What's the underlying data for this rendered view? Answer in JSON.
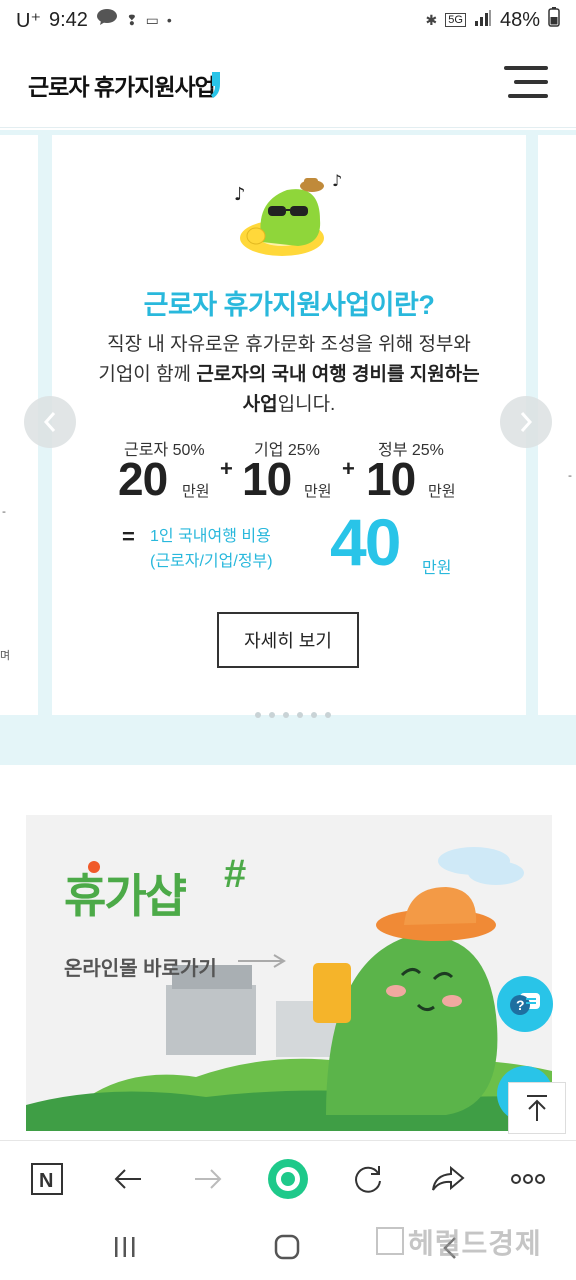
{
  "status_bar": {
    "carrier": "U⁺",
    "time": "9:42",
    "talk_badge": "TALK",
    "network": "5G",
    "battery": "48%"
  },
  "header": {
    "title": "근로자 휴가지원사업"
  },
  "slide": {
    "title": "근로자 휴가지원사업이란?",
    "desc_line1": "직장 내 자유로운 휴가문화 조성을 위해 정부와",
    "desc_line2_normal": "기업이 함께 ",
    "desc_line2_bold": "근로자의 국내 여행 경비를 지원하는",
    "desc_line3_bold": "사업",
    "desc_line3_normal": "입니다.",
    "contributions": [
      {
        "label": "근로자 50%",
        "amount": "20",
        "unit": "만원"
      },
      {
        "label": "기업 25%",
        "amount": "10",
        "unit": "만원"
      },
      {
        "label": "정부 25%",
        "amount": "10",
        "unit": "만원"
      }
    ],
    "plus": "+",
    "equals": "=",
    "total_label_1": "1인 국내여행 비용",
    "total_label_2": "(근로자/기업/정부)",
    "total_amount": "40",
    "total_unit": "만원",
    "detail_button": "자세히 보기"
  },
  "banner": {
    "title": "휴가샵",
    "subtitle": "온라인몰 바로가기"
  },
  "watermark": "헤럴드경제",
  "colors": {
    "accent": "#29b8dc",
    "slider_bg": "#e4f5f8",
    "banner_green": "#4caa48"
  }
}
